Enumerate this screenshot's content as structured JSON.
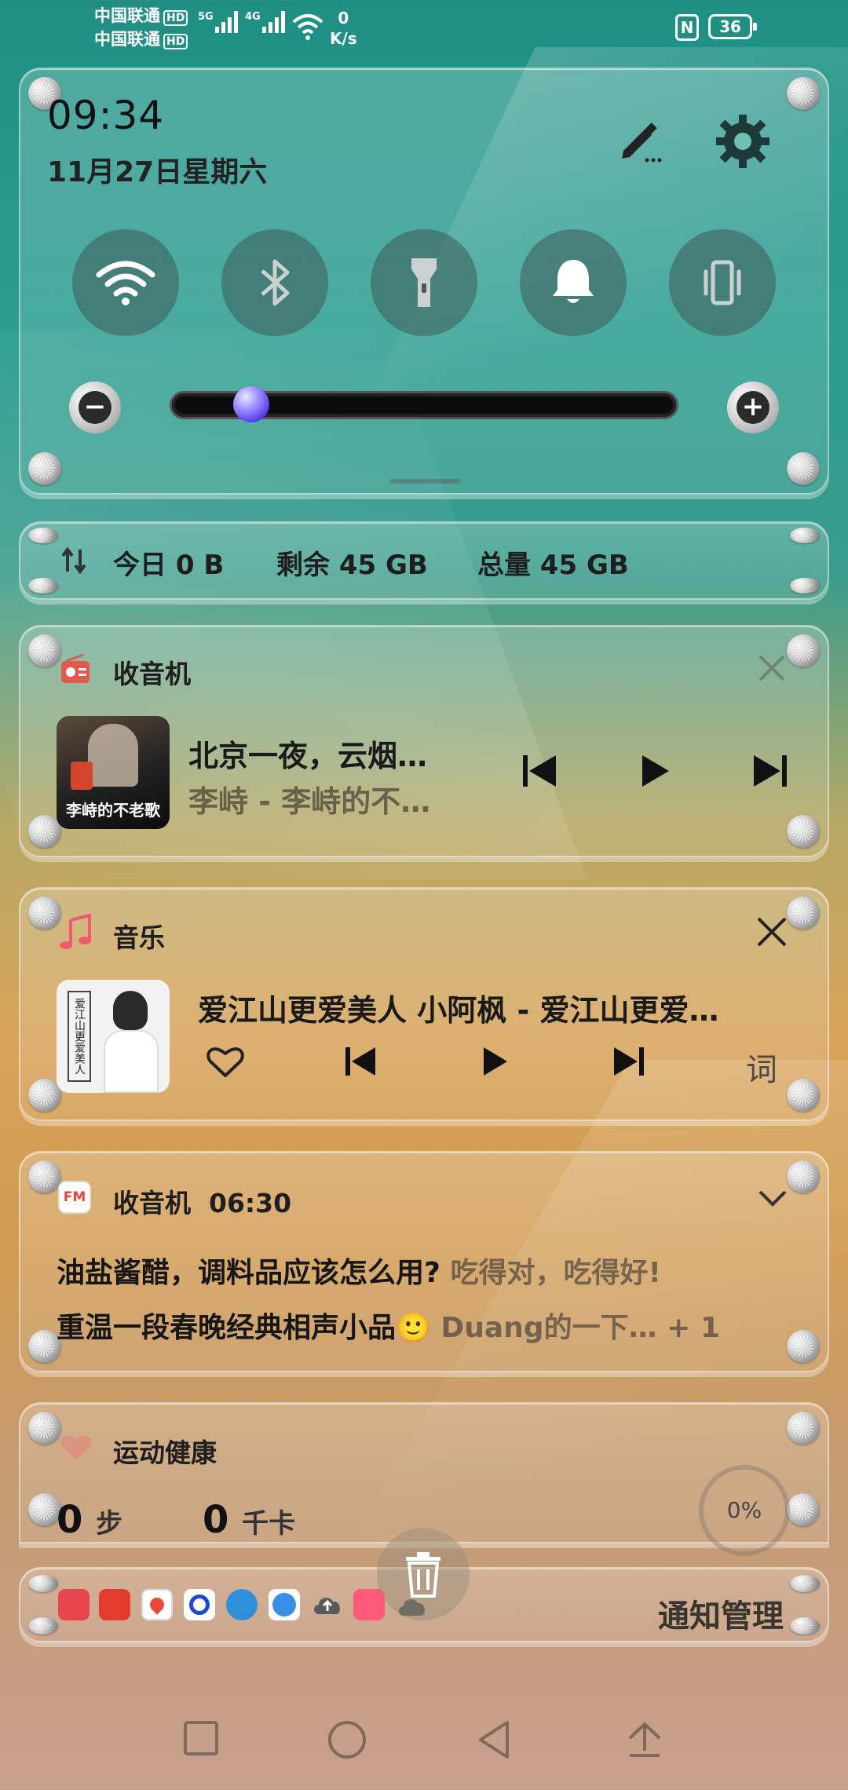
{
  "status_bar": {
    "carrier1": "中国联通",
    "carrier2": "中国联通",
    "hd": "HD",
    "net1_type": "5G",
    "net2_type": "4G",
    "speed_value": "0",
    "speed_unit": "K/s",
    "nfc": "N",
    "battery": "36"
  },
  "quick_settings": {
    "time": "09:34",
    "date": "11月27日星期六",
    "toggles": [
      "wifi",
      "bluetooth",
      "flashlight",
      "sound",
      "vibrate"
    ],
    "brightness_level": 0.13,
    "minus_label": "−",
    "plus_label": "+"
  },
  "storage": {
    "today": "今日 0 B",
    "remaining": "剩余 45 GB",
    "total": "总量 45 GB"
  },
  "notif_radio": {
    "app": "收音机",
    "title": "北京一夜，云烟…",
    "subtitle": "李峙 - 李峙的不…",
    "album_text": "李峙的不老歌"
  },
  "notif_music": {
    "app": "音乐",
    "title": "爱江山更爱美人 小阿枫 - 爱江山更爱…",
    "lyrics_label": "词",
    "album_text": "爱江山更爱美人"
  },
  "notif_radio2": {
    "app": "收音机",
    "time": "06:30",
    "icon_label": "FM",
    "line1_main": "油盐酱醋，调料品应该怎么用?",
    "line1_dim": "吃得对，吃得好!",
    "line2_main": "重温一段春晚经典相声小品🙂",
    "line2_dim": "Duang的一下…",
    "more": "+ 1"
  },
  "notif_health": {
    "app": "运动健康",
    "steps": "0",
    "steps_unit": "步",
    "kcal": "0",
    "kcal_unit": "千卡",
    "progress": "0%"
  },
  "dock": {
    "manage_label": "通知管理",
    "colors": {
      "icon1": "#e8444f",
      "icon2": "#e33b2e",
      "icon3": "#ffffff",
      "icon4": "#ffffff",
      "icon5": "#2f8fd8",
      "icon6": "#ffffff",
      "icon7": "#5a5a5a",
      "icon8": "#ff5a7a",
      "icon9": "#555555"
    }
  }
}
